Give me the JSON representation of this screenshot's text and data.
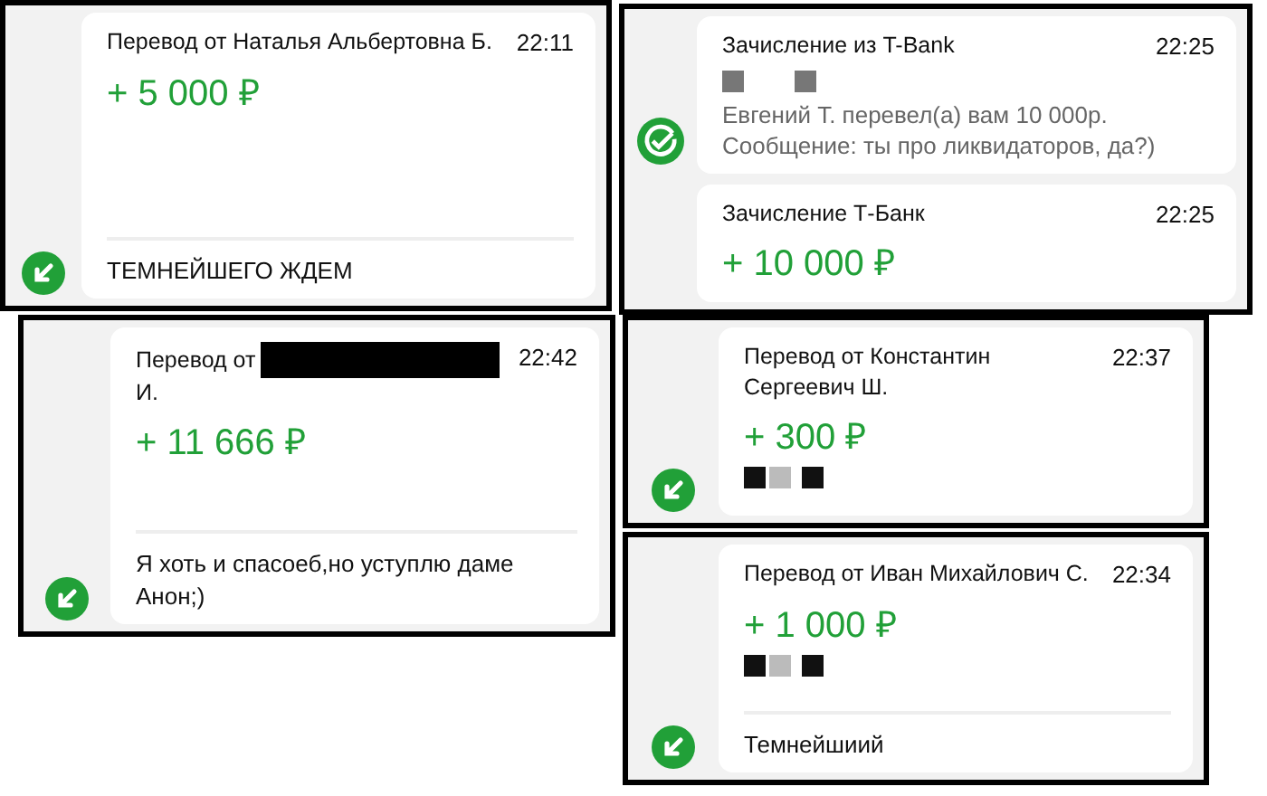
{
  "panels": [
    {
      "kind": "arrow",
      "cards": [
        {
          "title": "Перевод от Наталья Альбертовна Б.",
          "time": "22:11",
          "amount": "+ 5 000 ₽",
          "message": "ТЕМНЕЙШЕГО ЖДЕМ"
        }
      ]
    },
    {
      "kind": "check",
      "cards": [
        {
          "title": "Зачисление из T-Bank",
          "time": "22:25",
          "redacted": true,
          "body": "Евгений Т. перевел(а) вам 10 000р. Сообщение: ты про ликвидаторов, да?)"
        },
        {
          "title": "Зачисление Т-Банк",
          "time": "22:25",
          "amount": "+ 10 000 ₽"
        }
      ]
    },
    {
      "kind": "arrow",
      "cards": [
        {
          "title": "Перевод от",
          "redacted": true,
          "title_tail": "И.",
          "time": "22:42",
          "amount": "+ 11 666 ₽",
          "message": "Я хоть и спасоеб,но уступлю даме Анон;)"
        }
      ]
    },
    {
      "kind": "arrow",
      "cards": [
        {
          "title": "Перевод от Константин Сергеевич Ш.",
          "time": "22:37",
          "amount": "+ 300 ₽",
          "redacted": true
        }
      ]
    },
    {
      "kind": "arrow",
      "cards": [
        {
          "title": "Перевод от Иван Михайлович С.",
          "time": "22:34",
          "amount": "+ 1 000 ₽",
          "redacted": true,
          "message": "Темнейшиий"
        }
      ]
    }
  ]
}
